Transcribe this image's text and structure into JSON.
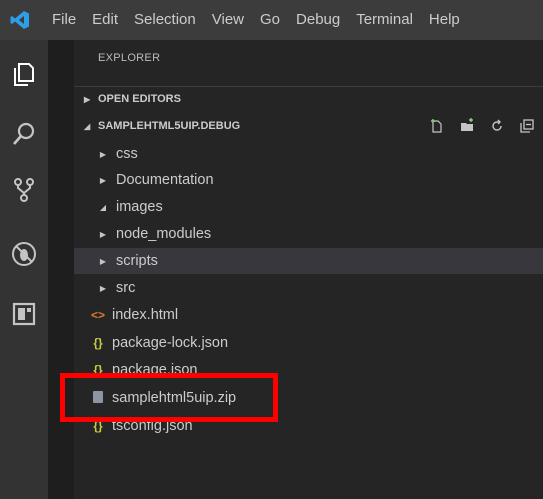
{
  "menubar": {
    "items": [
      "File",
      "Edit",
      "Selection",
      "View",
      "Go",
      "Debug",
      "Terminal",
      "Help"
    ]
  },
  "activitybar": {
    "icons": [
      "files-icon",
      "search-icon",
      "source-control-icon",
      "debug-icon",
      "extensions-icon"
    ]
  },
  "explorer": {
    "title": "EXPLORER",
    "open_editors": "OPEN EDITORS",
    "project": "SAMPLEHTML5UIP.DEBUG",
    "tree": [
      {
        "label": "css",
        "kind": "folder",
        "expanded": false
      },
      {
        "label": "Documentation",
        "kind": "folder",
        "expanded": false
      },
      {
        "label": "images",
        "kind": "folder",
        "expanded": true
      },
      {
        "label": "node_modules",
        "kind": "folder",
        "expanded": false
      },
      {
        "label": "scripts",
        "kind": "folder",
        "expanded": false,
        "selected": true
      },
      {
        "label": "src",
        "kind": "folder",
        "expanded": false
      },
      {
        "label": "index.html",
        "kind": "file",
        "icon": "<>"
      },
      {
        "label": "package-lock.json",
        "kind": "file",
        "icon": "{}"
      },
      {
        "label": "package.json",
        "kind": "file",
        "icon": "{}"
      },
      {
        "label": "samplehtml5uip.zip",
        "kind": "file",
        "icon": "zip"
      },
      {
        "label": "tsconfig.json",
        "kind": "file",
        "icon": "{}"
      }
    ]
  },
  "colors": {
    "accent": "#0e639c",
    "highlight_box": "#ff0000",
    "json_icon": "#cbcb41",
    "html_icon": "#e37933"
  }
}
